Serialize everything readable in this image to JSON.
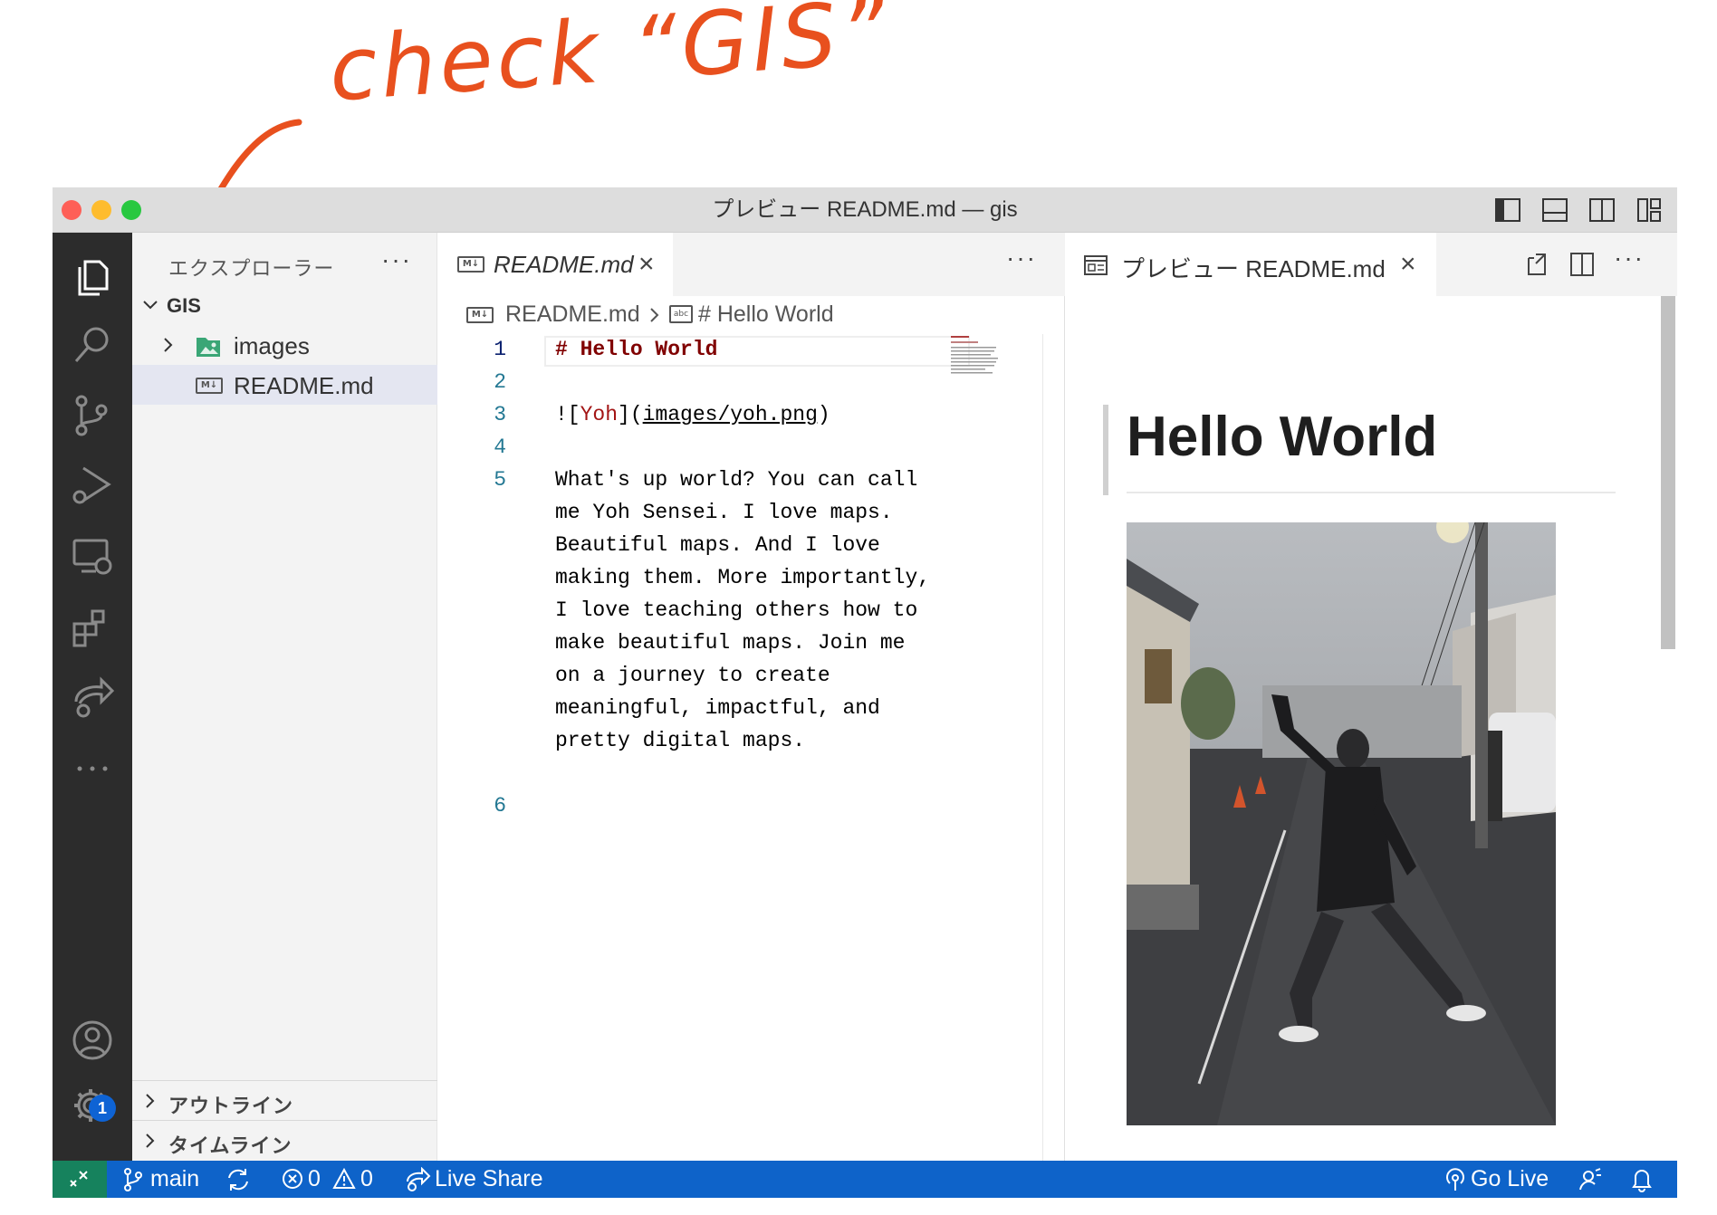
{
  "annotation": {
    "text": "check “GIS”"
  },
  "window": {
    "title": "プレビュー README.md — gis"
  },
  "sidebar": {
    "header": "エクスプローラー",
    "more": "···",
    "root": "GIS",
    "items": [
      {
        "label": "images",
        "icon": "folder-image-icon"
      },
      {
        "label": "README.md",
        "icon": "markdown-file-icon"
      }
    ],
    "sections": [
      {
        "label": "アウトライン"
      },
      {
        "label": "タイムライン"
      }
    ]
  },
  "editor": {
    "tab_label": "README.md",
    "more": "···",
    "breadcrumb": {
      "file": "README.md",
      "symbol": "# Hello World"
    },
    "line_numbers": [
      "1",
      "2",
      "3",
      "4",
      "5",
      "6"
    ],
    "lines": {
      "l1": "# Hello World",
      "l3_prefix": "![",
      "l3_text": "Yoh",
      "l3_mid": "](",
      "l3_url": "images/yoh.png",
      "l3_suffix": ")",
      "l5": [
        "What's up world? You can call",
        "me Yoh Sensei. I love maps.",
        "Beautiful maps. And I love",
        "making them. More importantly,",
        "I love teaching others how to",
        "make beautiful maps. Join me",
        "on a journey to create",
        "meaningful, impactful, and",
        "pretty digital maps."
      ]
    }
  },
  "preview": {
    "tab_label": "プレビュー README.md",
    "more": "···",
    "heading": "Hello World"
  },
  "status": {
    "branch": "main",
    "errors": "0",
    "warnings": "0",
    "live_share": "Live Share",
    "go_live": "Go Live",
    "badge": "1"
  },
  "colors": {
    "accent": "#0e63c9",
    "annotation": "#e8501e",
    "activity_bg": "#2c2c2c"
  }
}
